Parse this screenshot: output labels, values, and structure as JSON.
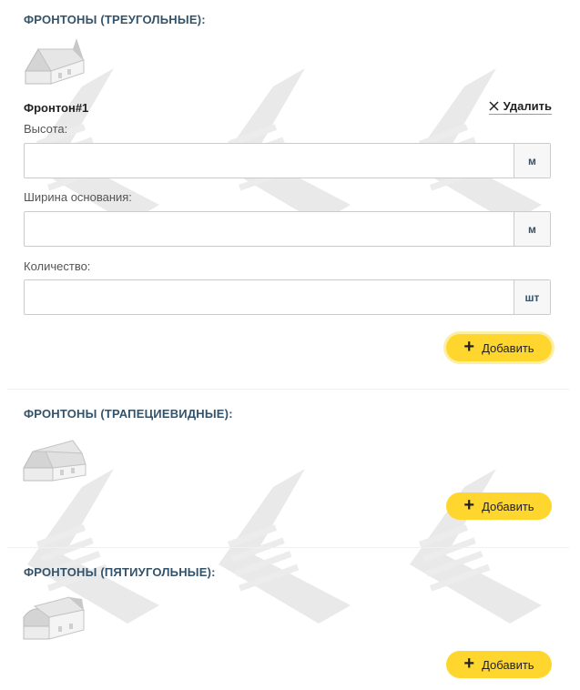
{
  "sections": [
    {
      "title": "ФРОНТОНЫ (ТРЕУГОЛЬНЫЕ):",
      "icon": "triangular-gable-house-icon",
      "gable": {
        "title": "Фронтон#1",
        "delete_label": "Удалить",
        "fields": [
          {
            "label": "Высота:",
            "value": "",
            "unit": "м"
          },
          {
            "label": "Ширина основания:",
            "value": "",
            "unit": "м"
          },
          {
            "label": "Количество:",
            "value": "",
            "unit": "шт"
          }
        ]
      },
      "add_label": "Добавить"
    },
    {
      "title": "ФРОНТОНЫ (ТРАПЕЦИЕВИДНЫЕ):",
      "icon": "trapezoid-gable-house-icon",
      "add_label": "Добавить"
    },
    {
      "title": "ФРОНТОНЫ (ПЯТИУГОЛЬНЫЕ):",
      "icon": "pentagon-gable-house-icon",
      "add_label": "Добавить"
    }
  ],
  "colors": {
    "accent": "#ffd62e",
    "heading": "#34536a",
    "border": "#c9cbcd"
  }
}
